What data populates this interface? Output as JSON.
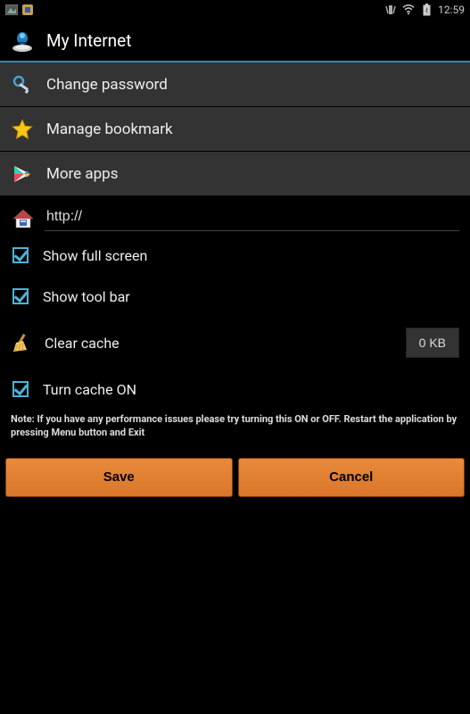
{
  "status": {
    "time": "12:59"
  },
  "header": {
    "title": "My Internet"
  },
  "menu": {
    "change_password": "Change password",
    "manage_bookmark": "Manage bookmark",
    "more_apps": "More apps"
  },
  "home": {
    "url": "http://"
  },
  "options": {
    "show_full_screen": {
      "label": "Show full screen",
      "checked": true
    },
    "show_tool_bar": {
      "label": "Show tool bar",
      "checked": true
    },
    "turn_cache_on": {
      "label": "Turn cache ON",
      "checked": true
    }
  },
  "cache": {
    "clear_label": "Clear cache",
    "size_label": "0 KB"
  },
  "note": "Note: If you have any performance issues please try turning this ON or OFF. Restart the application by pressing Menu button and Exit",
  "buttons": {
    "save": "Save",
    "cancel": "Cancel"
  }
}
